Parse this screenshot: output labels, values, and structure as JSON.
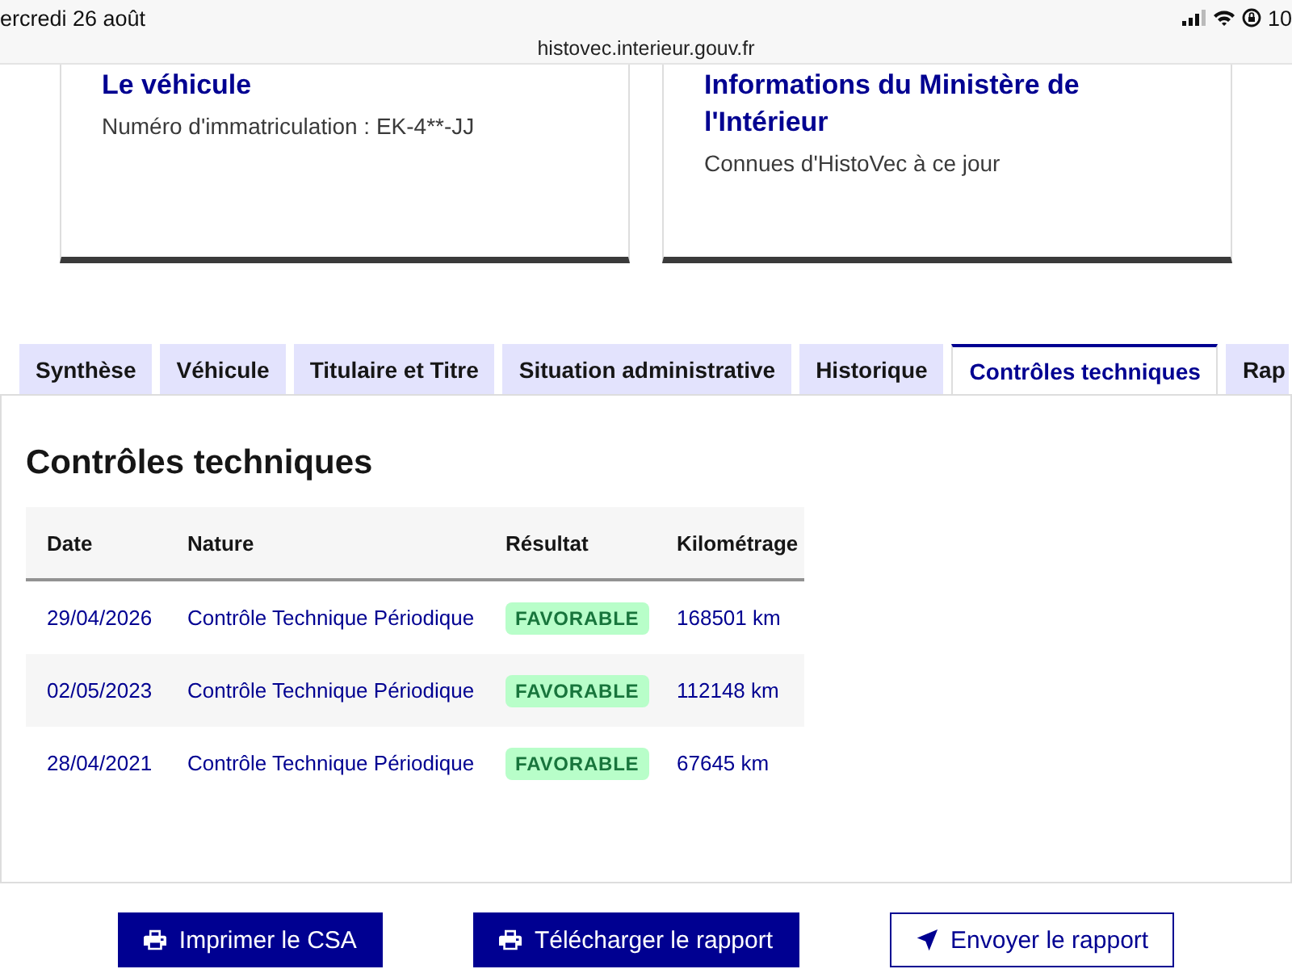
{
  "status_bar": {
    "date": "ercredi 26 août",
    "battery": "10"
  },
  "browser": {
    "url": "histovec.interieur.gouv.fr"
  },
  "cards": [
    {
      "title": "Le véhicule",
      "text": "Numéro d'immatriculation : EK-4**-JJ"
    },
    {
      "title": "Informations du Ministère de l'Intérieur",
      "text": "Connues d'HistoVec à ce jour"
    }
  ],
  "tabs": [
    {
      "label": "Synthèse",
      "selected": false
    },
    {
      "label": "Véhicule",
      "selected": false
    },
    {
      "label": "Titulaire et Titre",
      "selected": false
    },
    {
      "label": "Situation administrative",
      "selected": false
    },
    {
      "label": "Historique",
      "selected": false
    },
    {
      "label": "Contrôles techniques",
      "selected": true
    },
    {
      "label": "Rap",
      "selected": false
    }
  ],
  "panel": {
    "title": "Contrôles techniques",
    "table": {
      "columns": [
        "Date",
        "Nature",
        "Résultat",
        "Kilométrage"
      ],
      "rows": [
        {
          "date": "29/04/2026",
          "nature": "Contrôle Technique Périodique",
          "result": "FAVORABLE",
          "mileage": "168501 km"
        },
        {
          "date": "02/05/2023",
          "nature": "Contrôle Technique Périodique",
          "result": "FAVORABLE",
          "mileage": "112148 km"
        },
        {
          "date": "28/04/2021",
          "nature": "Contrôle Technique Périodique",
          "result": "FAVORABLE",
          "mileage": "67645 km"
        }
      ]
    }
  },
  "actions": [
    {
      "label": "Imprimer le CSA",
      "kind": "primary"
    },
    {
      "label": "Télécharger le rapport",
      "kind": "primary"
    },
    {
      "label": "Envoyer le rapport",
      "kind": "secondary"
    }
  ]
}
